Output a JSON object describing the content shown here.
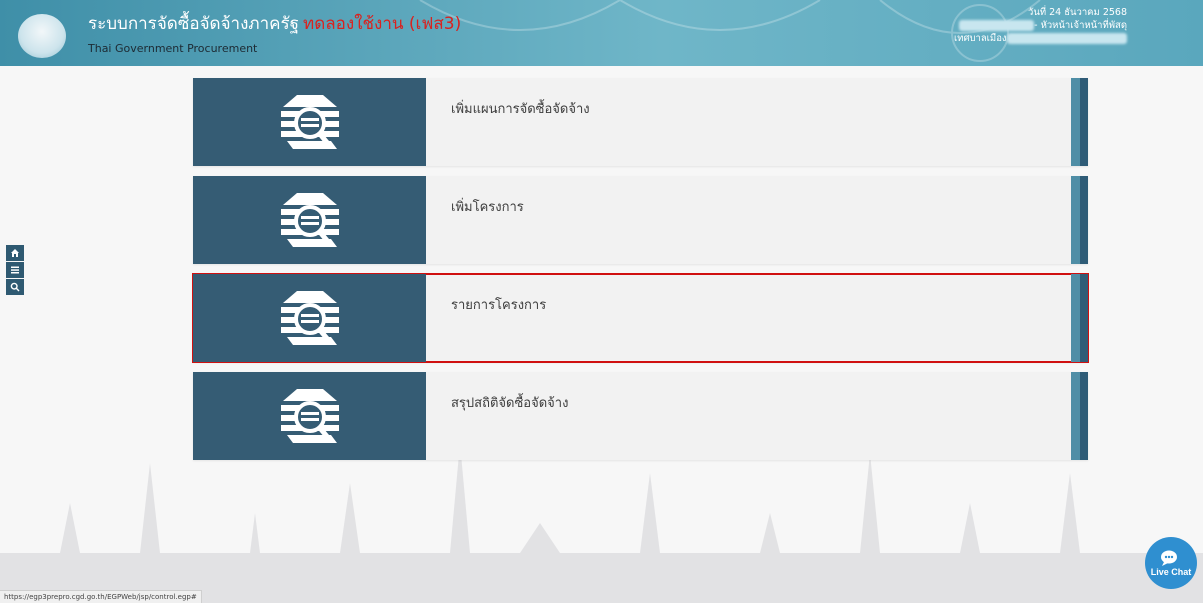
{
  "header": {
    "title": "ระบบการจัดซื้อจัดจ้างภาครัฐ",
    "title_badge": "ทดลองใช้งาน (เฟส3)",
    "subtitle": "Thai Government Procurement",
    "date": "วันที่ 24 ธันวาคม 2568",
    "role": "- หัวหน้าเจ้าหน้าที่พัสดุ",
    "org": "เทศบาลเมือง"
  },
  "left_tools": [
    "home-icon",
    "menu-icon",
    "search-icon"
  ],
  "menu": [
    {
      "label": "เพิ่มแผนการจัดซื้อจัดจ้าง"
    },
    {
      "label": "เพิ่มโครงการ"
    },
    {
      "label": "รายการโครงการ"
    },
    {
      "label": "สรุปสถิติจัดซื้อจัดจ้าง"
    }
  ],
  "status_url": "https://egp3prepro.cgd.go.th/EGPWeb/jsp/control.egp#",
  "live_chat_label": "Live Chat",
  "colors": {
    "card_icon_bg": "#355c74",
    "highlight_border": "#d01010",
    "title_badge": "#d9221f"
  }
}
